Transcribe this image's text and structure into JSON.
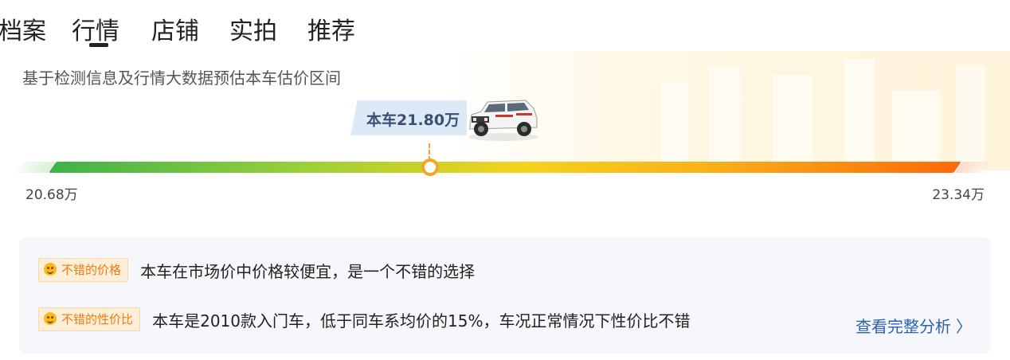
{
  "tabs": [
    {
      "label": "档案"
    },
    {
      "label": "行情"
    },
    {
      "label": "店铺"
    },
    {
      "label": "实拍"
    },
    {
      "label": "推荐"
    }
  ],
  "active_tab": "行情",
  "estimate": {
    "subtitle": "基于检测信息及行情大数据预估本车估价区间",
    "current_label": "本车21.80万",
    "min_label": "20.68万",
    "max_label": "23.34万",
    "position_fraction": 0.42
  },
  "analysis": {
    "rows": [
      {
        "badge": "不错的价格",
        "text": "本车在市场价中价格较便宜，是一个不错的选择",
        "icon": "smile-icon"
      },
      {
        "badge": "不错的性价比",
        "text": "本车是2010款入门车，低于同车系均价的15%，车况正常情况下性价比不错",
        "icon": "smile-icon"
      }
    ],
    "more_link": "查看完整分析",
    "more_icon": "chevron-right-icon"
  },
  "colors": {
    "accent_orange": "#f5a623",
    "link_blue": "#2f5fb3",
    "bar_start": "#3fb24a",
    "bar_end": "#fb6a0c"
  }
}
